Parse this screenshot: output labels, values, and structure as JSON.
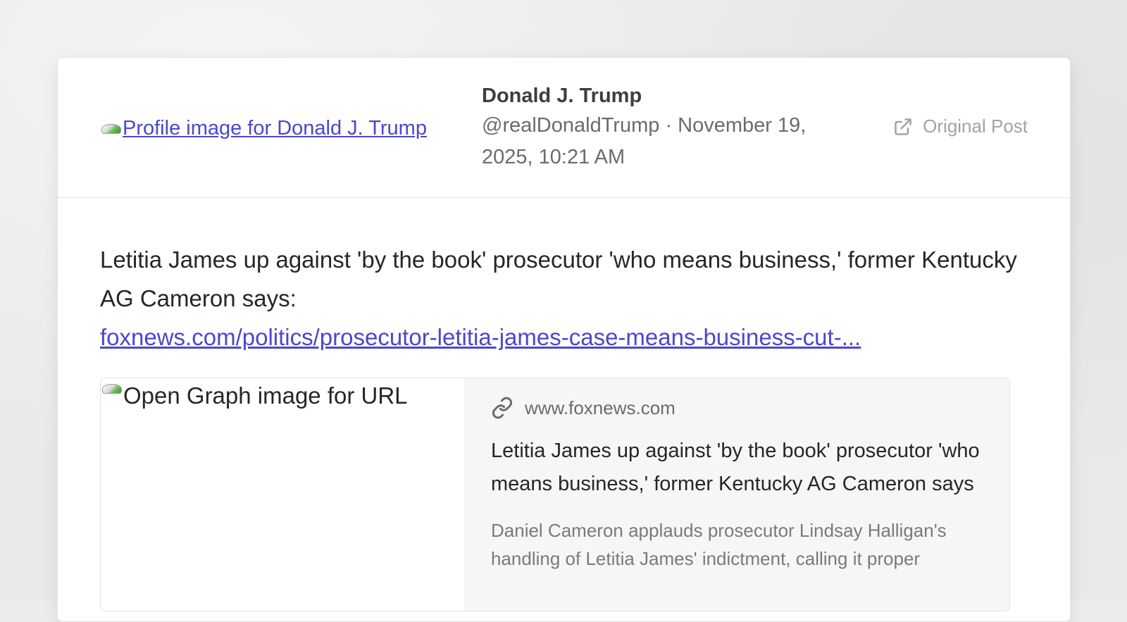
{
  "header": {
    "avatar_alt": "Profile image for Donald J. Trump",
    "author_name": "Donald J. Trump",
    "author_meta": "@realDonaldTrump · November 19, 2025, 10:21 AM",
    "original_post_label": "Original Post",
    "original_post_icon": "external-link-icon"
  },
  "post": {
    "text": "Letitia James up against 'by the book' prosecutor 'who means business,' former Kentucky AG Cameron says:",
    "link_text": "foxnews.com/politics/prosecutor-letitia-james-case-means-business-cut-..."
  },
  "link_card": {
    "image_alt": "Open Graph image for URL",
    "domain_icon": "link-icon",
    "domain": "www.foxnews.com",
    "title": "Letitia James up against 'by the book' prosecutor 'who means business,' former Kentucky AG Cameron says",
    "description": "Daniel Cameron applauds prosecutor Lindsay Halligan's handling of Letitia James' indictment, calling it proper"
  }
}
